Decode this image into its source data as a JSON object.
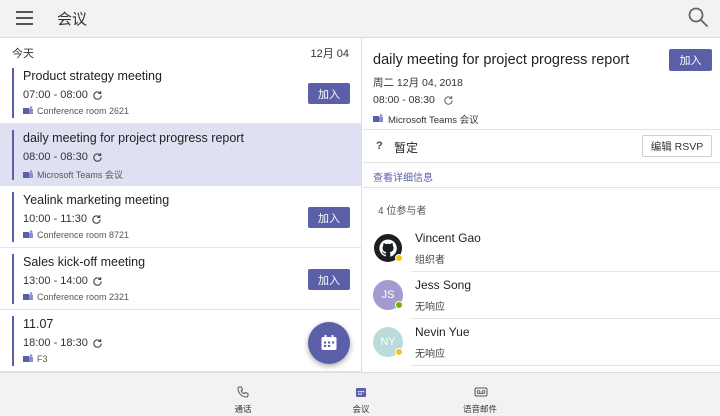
{
  "header": {
    "title": "会议",
    "menu_icon": "hamburger-menu-icon",
    "search_icon": "search-icon"
  },
  "list": {
    "today_label": "今天",
    "date_label": "12月 04",
    "meetings": [
      {
        "title": "Product strategy meeting",
        "time": "07:00 - 08:00",
        "location": "Conference room 2621",
        "join_label": "加入",
        "selected": false
      },
      {
        "title": "daily meeting for project progress report",
        "time": "08:00 - 08:30",
        "location": "Microsoft Teams 会议",
        "join_label": "",
        "selected": true
      },
      {
        "title": "Yealink marketing meeting",
        "time": "10:00 - 11:30",
        "location": "Conference room 8721",
        "join_label": "加入",
        "selected": false
      },
      {
        "title": "Sales kick-off meeting",
        "time": "13:00 - 14:00",
        "location": "Conference room 2321",
        "join_label": "加入",
        "selected": false
      },
      {
        "title": "11.07",
        "time": "18:00 - 18:30",
        "location": "F3",
        "join_label": "",
        "selected": false
      }
    ]
  },
  "detail": {
    "title": "daily meeting for project progress report",
    "join_label": "加入",
    "date": "周二 12月 04, 2018",
    "time": "08:00 - 08:30",
    "location": "Microsoft Teams 会议",
    "rsvp_mark": "?",
    "rsvp_status": "暂定",
    "rsvp_button": "编辑 RSVP",
    "more_info": "查看详细信息",
    "attendee_count": "4 位参与者",
    "attendees": [
      {
        "name": "Vincent Gao",
        "role": "组织者",
        "initials": "",
        "avatar_color": "#ffffff",
        "presence_color": "#f0c419"
      },
      {
        "name": "Jess Song",
        "role": "无响应",
        "initials": "JS",
        "avatar_color": "#a49ad0",
        "presence_color": "#6bb700"
      },
      {
        "name": "Nevin Yue",
        "role": "无响应",
        "initials": "NY",
        "avatar_color": "#b9dbd9",
        "presence_color": "#f0c419"
      }
    ]
  },
  "nav": {
    "items": [
      {
        "label": "通话",
        "icon": "phone-icon"
      },
      {
        "label": "会议",
        "icon": "calendar-icon"
      },
      {
        "label": "语音邮件",
        "icon": "voicemail-icon"
      }
    ]
  },
  "colors": {
    "accent": "#5b5fa8",
    "selected_row": "#dfe0f1"
  }
}
